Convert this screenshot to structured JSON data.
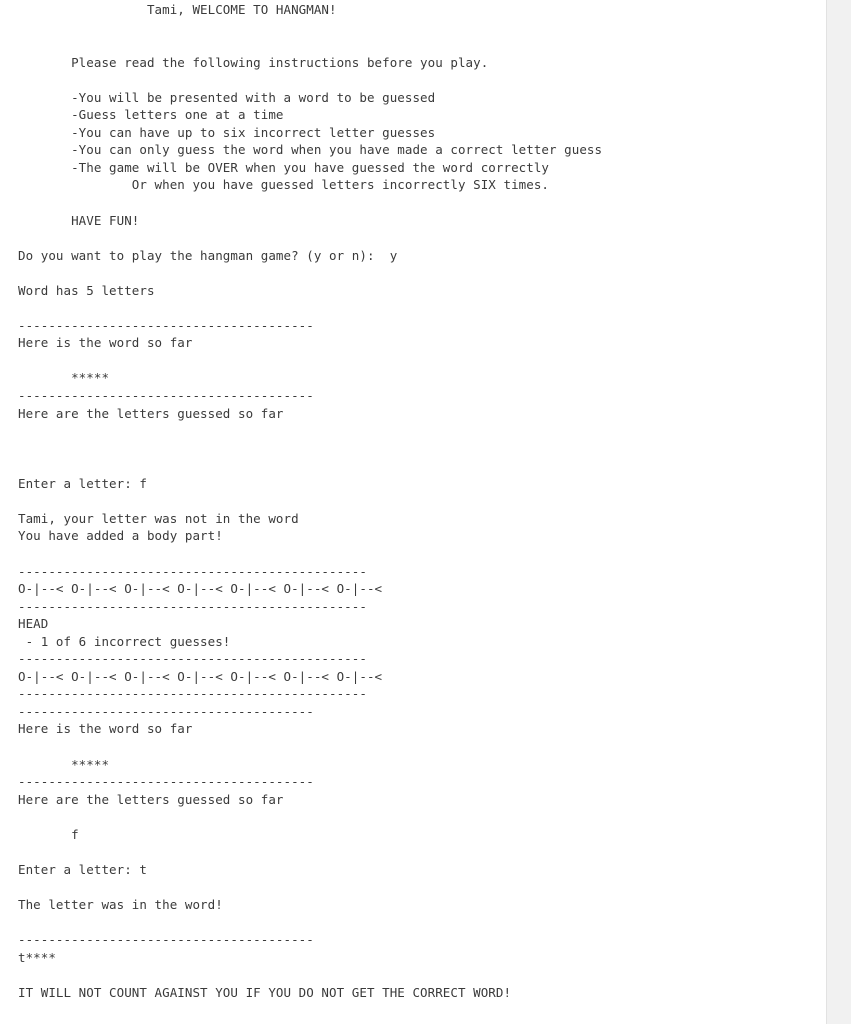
{
  "program": {
    "title_line": "                 Tami, WELCOME TO HANGMAN!",
    "player_name": "Tami",
    "word_length": 5,
    "max_incorrect": 6,
    "text_color": "#3a3a3a",
    "background_color": "#ffffff",
    "scrollbar_track_color": "#f1f1f1"
  },
  "lines": [
    "                 Tami, WELCOME TO HANGMAN!",
    "",
    "",
    "       Please read the following instructions before you play.",
    "",
    "       -You will be presented with a word to be guessed",
    "       -Guess letters one at a time",
    "       -You can have up to six incorrect letter guesses",
    "       -You can only guess the word when you have made a correct letter guess",
    "       -The game will be OVER when you have guessed the word correctly",
    "               Or when you have guessed letters incorrectly SIX times.",
    "",
    "       HAVE FUN!",
    "",
    "Do you want to play the hangman game? (y or n):  y",
    "",
    "Word has 5 letters",
    "",
    "---------------------------------------",
    "Here is the word so far",
    "",
    "       *****",
    "---------------------------------------",
    "Here are the letters guessed so far",
    "",
    "",
    "",
    "Enter a letter: f",
    "",
    "Tami, your letter was not in the word",
    "You have added a body part!",
    "",
    "----------------------------------------------",
    "O-|--< O-|--< O-|--< O-|--< O-|--< O-|--< O-|--<",
    "----------------------------------------------",
    "HEAD",
    " - 1 of 6 incorrect guesses!",
    "----------------------------------------------",
    "O-|--< O-|--< O-|--< O-|--< O-|--< O-|--< O-|--<",
    "----------------------------------------------",
    "---------------------------------------",
    "Here is the word so far",
    "",
    "       *****",
    "---------------------------------------",
    "Here are the letters guessed so far",
    "",
    "       f",
    "",
    "Enter a letter: t",
    "",
    "The letter was in the word!",
    "",
    "---------------------------------------",
    "t****",
    "",
    "IT WILL NOT COUNT AGAINST YOU IF YOU DO NOT GET THE CORRECT WORD!"
  ],
  "sections": {
    "welcome_heading": "Tami, WELCOME TO HANGMAN!",
    "instructions_intro": "Please read the following instructions before you play.",
    "instructions": [
      "-You will be presented with a word to be guessed",
      "-Guess letters one at a time",
      "-You can have up to six incorrect letter guesses",
      "-You can only guess the word when you have made a correct letter guess",
      "-The game will be OVER when you have guessed the word correctly",
      "Or when you have guessed letters incorrectly SIX times."
    ],
    "have_fun": "HAVE FUN!",
    "play_prompt": "Do you want to play the hangman game? (y or n):",
    "play_answer": "y",
    "word_length_msg": "Word has 5 letters",
    "word_so_far_label": "Here is the word so far",
    "word_so_far_1": "*****",
    "guessed_letters_label": "Here are the letters guessed so far",
    "guessed_letters_1": "",
    "enter_letter_prompt_1": "Enter a letter:",
    "entered_letter_1": "f",
    "wrong_letter_msg": "Tami, your letter was not in the word",
    "body_part_msg": "You have added a body part!",
    "hangman_art": "O-|--< O-|--< O-|--< O-|--< O-|--< O-|--< O-|--<",
    "body_part_name": "HEAD",
    "incorrect_count_msg": " - 1 of 6 incorrect guesses!",
    "word_so_far_2": "*****",
    "guessed_letters_2": "f",
    "enter_letter_prompt_2": "Enter a letter:",
    "entered_letter_2": "t",
    "correct_letter_msg": "The letter was in the word!",
    "word_so_far_3": "t****",
    "footer_note": "IT WILL NOT COUNT AGAINST YOU IF YOU DO NOT GET THE CORRECT WORD!",
    "separator_short": "---------------------------------------",
    "separator_long": "----------------------------------------------"
  }
}
